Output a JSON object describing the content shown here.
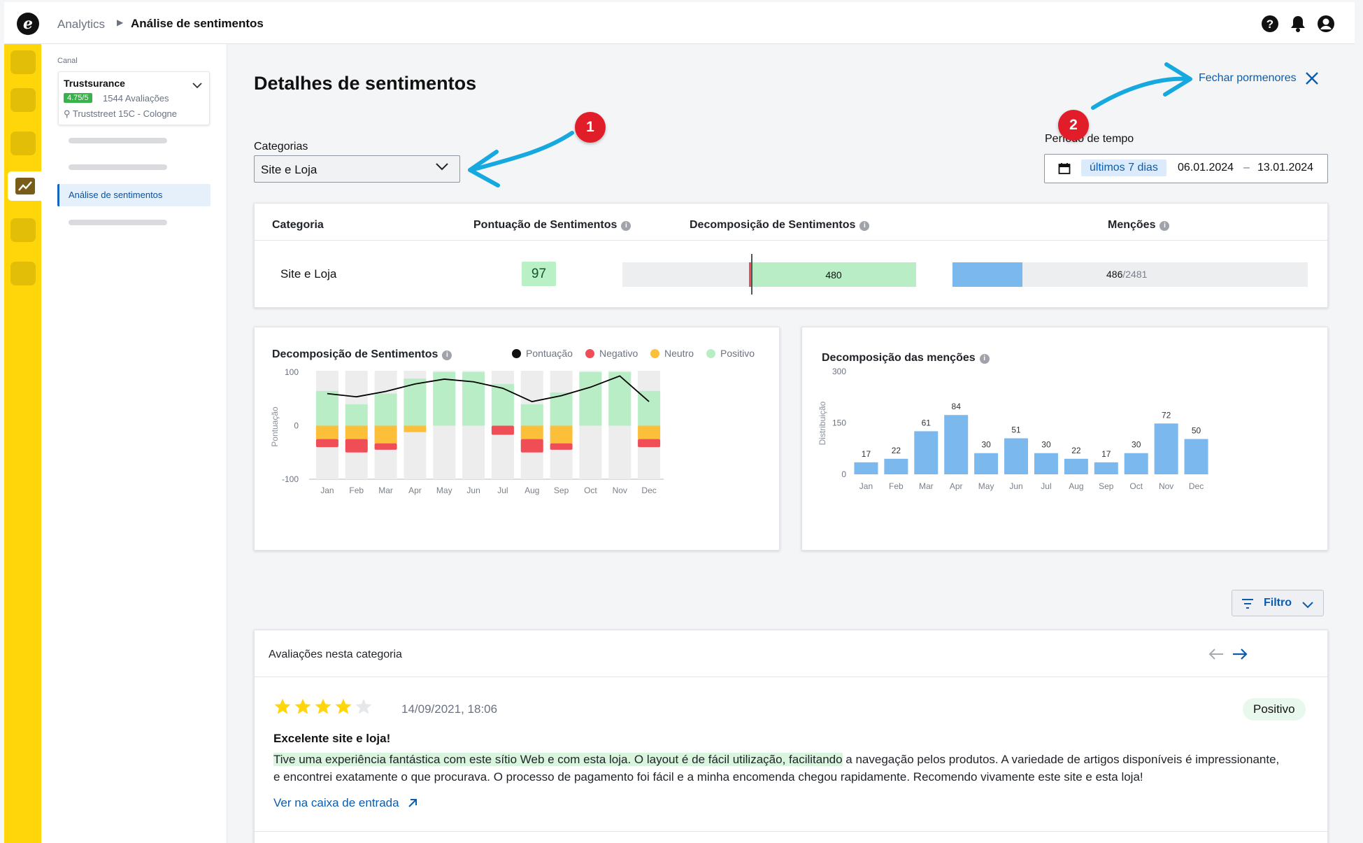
{
  "topbar": {
    "logo_letter": "e",
    "breadcrumb_root": "Analytics",
    "breadcrumb_current": "Análise de sentimentos",
    "icons": [
      "help-icon",
      "bell-icon",
      "user-icon"
    ]
  },
  "sidebar": {
    "canal_label": "Canal",
    "canal_name": "Trustsurance",
    "rating": "4.75/5",
    "reviews": "1544 Avaliações",
    "address": "Truststreet 15C - Cologne",
    "active_item": "Análise de sentimentos"
  },
  "header": {
    "title": "Detalhes de sentimentos",
    "close_label": "Fechar pormenores"
  },
  "filters": {
    "category_label": "Categorias",
    "category_value": "Site e Loja",
    "period_label": "Período de tempo",
    "period_chip": "últimos 7 dias",
    "date_from": "06.01.2024",
    "date_sep": "–",
    "date_to": "13.01.2024"
  },
  "annotations": {
    "one": "1",
    "two": "2"
  },
  "table": {
    "headers": [
      "Categoria",
      "Pontuação de Sentimentos",
      "Decomposição de Sentimentos",
      "Menções"
    ],
    "row": {
      "category": "Site e Loja",
      "score": "97",
      "positive_count": "480",
      "mentions": "486",
      "mentions_total": "/2481",
      "mentions_fraction": 0.196
    }
  },
  "colors": {
    "score": "#000000",
    "negative": "#ef4e57",
    "neutral": "#fbbf3a",
    "positive": "#b9edc6",
    "mentions_bar": "#7bb8ee",
    "accent": "#0b5cad",
    "rail": "#ffd60a"
  },
  "chart_data": [
    {
      "type": "bar",
      "title": "Decomposição de Sentimentos",
      "ylabel": "Pontuação",
      "ylim": [
        -100,
        100
      ],
      "yticks": [
        "100",
        "0",
        "-100"
      ],
      "categories": [
        "Jan",
        "Feb",
        "Mar",
        "Apr",
        "May",
        "Jun",
        "Jul",
        "Aug",
        "Sep",
        "Oct",
        "Nov",
        "Dec"
      ],
      "legend": [
        "Pontuação",
        "Negativo",
        "Neutro",
        "Positivo"
      ],
      "legend_placement": "top-right",
      "series": [
        {
          "name": "Positivo",
          "values": [
            65,
            40,
            60,
            88,
            100,
            100,
            78,
            40,
            62,
            100,
            100,
            65
          ]
        },
        {
          "name": "Neutro",
          "values": [
            -25,
            -25,
            -33,
            -12,
            0,
            0,
            0,
            -25,
            -33,
            0,
            0,
            -25
          ]
        },
        {
          "name": "Negativo",
          "values": [
            -15,
            -25,
            -12,
            0,
            0,
            0,
            -17,
            -25,
            -12,
            0,
            0,
            -15
          ]
        },
        {
          "name": "Pontuação",
          "values": [
            60,
            54,
            64,
            78,
            87,
            82,
            70,
            45,
            56,
            72,
            93,
            45
          ]
        }
      ]
    },
    {
      "type": "bar",
      "title": "Decomposição das menções",
      "ylabel": "Distribuição",
      "ylim": [
        0,
        300
      ],
      "yticks": [
        "300",
        "150",
        "0"
      ],
      "categories": [
        "Jan",
        "Feb",
        "Mar",
        "Apr",
        "May",
        "Jun",
        "Jul",
        "Aug",
        "Sep",
        "Oct",
        "Nov",
        "Dec"
      ],
      "values": [
        17,
        22,
        61,
        84,
        30,
        51,
        30,
        22,
        17,
        30,
        72,
        50
      ]
    }
  ],
  "filter_button": "Filtro",
  "reviews": {
    "title": "Avaliações nesta categoria",
    "item": {
      "stars": 4,
      "max_stars": 5,
      "date": "14/09/2021, 18:06",
      "sentiment": "Positivo",
      "headline": "Excelente site e loja!",
      "text_highlight": "Tive uma experiência fantástica com este sítio Web e com esta loja. O layout é de fácil utilização, facilitando",
      "text_rest": " a navegação pelos produtos. A variedade de artigos disponíveis é impressionante, e encontrei exatamente o que procurava. O processo de pagamento foi fácil e a minha encomenda chegou rapidamente. Recomendo vivamente este site e esta loja!",
      "link": "Ver na caixa de entrada"
    }
  }
}
